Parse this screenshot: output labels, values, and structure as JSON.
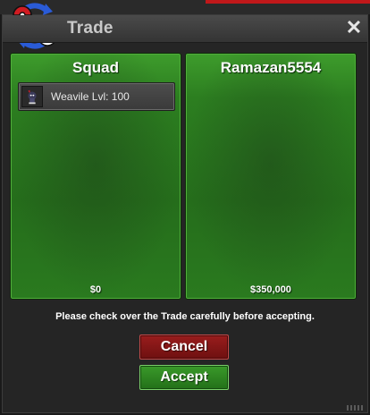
{
  "window": {
    "title": "Trade",
    "close_glyph": "✕"
  },
  "panels": {
    "left": {
      "title": "Squad",
      "money": "$0",
      "items": [
        {
          "label": "Weavile  Lvl: 100",
          "icon": "weavile-sprite"
        }
      ]
    },
    "right": {
      "title": "Ramazan5554",
      "money": "$350,000",
      "items": []
    }
  },
  "notice": "Please check over the Trade carefully before accepting.",
  "buttons": {
    "cancel": "Cancel",
    "accept": "Accept"
  },
  "colors": {
    "panel_green": "#2c7e20",
    "cancel_red": "#8a1a1a",
    "accept_green": "#2f8a22",
    "logo_red": "#d01c22",
    "logo_blue": "#2a5bd7"
  }
}
